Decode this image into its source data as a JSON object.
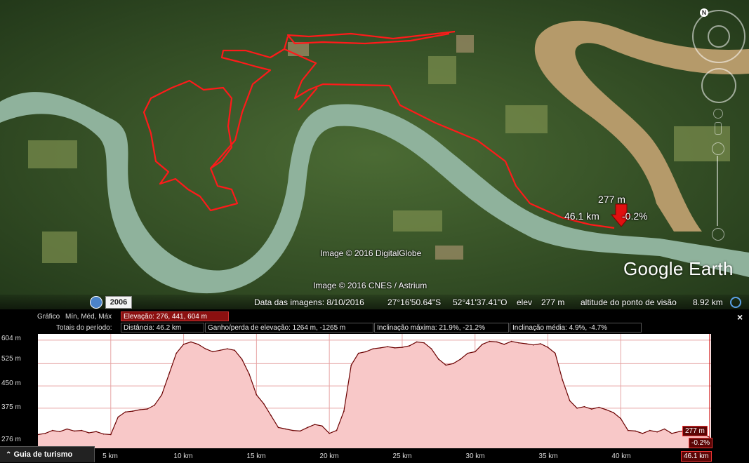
{
  "map": {
    "watermarks": [
      "Image © 2016 DigitalGlobe",
      "Image © 2016 CNES / Astrium"
    ],
    "logo": {
      "part1": "Google",
      "part2": "Earth"
    },
    "marker": {
      "elevation": "277 m",
      "distance": "46.1 km",
      "slope": "-0.2%"
    },
    "colors": {
      "river": "#8fb29c",
      "river_brown": "#b59a6a",
      "track": "#ff1a1a",
      "forest": "#2f4a22"
    }
  },
  "statusbar": {
    "history_year": "2006",
    "image_date": "Data das imagens: 8/10/2016",
    "lat": "27°16'50.64\"S",
    "lon": "52°41'37.41\"O",
    "elev_label": "elev",
    "elev_value": "277 m",
    "eye_label": "altitude do ponto de visão",
    "eye_value": "8.92 km"
  },
  "profile": {
    "graph_label": "Gráfico",
    "graph_options": "Mín, Méd, Máx",
    "elevation_summary": "Elevação: 276, 441, 604 m",
    "totals_label": "Totais do período:",
    "distance": "Distância: 46.2 km",
    "gain_loss": "Ganho/perda de elevação: 1264 m, -1265 m",
    "max_slope": "Inclinação máxima: 21.9%, -21.2%",
    "avg_slope": "Inclinação média: 4.9%, -4.7%",
    "close_label": "×",
    "tour_guide": "Guia de turismo",
    "y_ticks": [
      "604 m",
      "525 m",
      "450 m",
      "375 m",
      "276 m"
    ],
    "x_ticks": [
      "5 km",
      "10 km",
      "15 km",
      "20 km",
      "25 km",
      "30 km",
      "35 km",
      "40 km"
    ],
    "cursor_elev": "277 m",
    "cursor_slope": "-0.2%",
    "cursor_dist": "46.1 km"
  },
  "chart_data": {
    "type": "area",
    "xlabel": "",
    "ylabel": "",
    "xlim": [
      0,
      46.2
    ],
    "ylim": [
      276,
      604
    ],
    "x": [
      0,
      0.5,
      1,
      1.5,
      2,
      2.5,
      3,
      3.5,
      4,
      4.5,
      5,
      5.5,
      6,
      6.5,
      7,
      7.5,
      8,
      8.5,
      9,
      9.5,
      10,
      10.5,
      11,
      11.5,
      12,
      12.5,
      13,
      13.5,
      14,
      14.5,
      15,
      15.5,
      16,
      16.5,
      17,
      17.5,
      18,
      18.5,
      19,
      19.5,
      20,
      20.5,
      21,
      21.5,
      22,
      22.5,
      23,
      23.5,
      24,
      24.5,
      25,
      25.5,
      26,
      26.5,
      27,
      27.5,
      28,
      28.5,
      29,
      29.5,
      30,
      30.5,
      31,
      31.5,
      32,
      32.5,
      33,
      33.5,
      34,
      34.5,
      35,
      35.5,
      36,
      36.5,
      37,
      37.5,
      38,
      38.5,
      39,
      39.5,
      40,
      40.5,
      41,
      41.5,
      42,
      42.5,
      43,
      43.5,
      44,
      44.5,
      45,
      45.5,
      46.1
    ],
    "series": [
      {
        "values": [
          286,
          290,
          300,
          296,
          305,
          298,
          300,
          292,
          296,
          288,
          286,
          345,
          362,
          365,
          370,
          372,
          385,
          420,
          490,
          560,
          590,
          598,
          590,
          575,
          565,
          570,
          575,
          570,
          540,
          490,
          420,
          390,
          350,
          310,
          305,
          300,
          298,
          310,
          320,
          315,
          290,
          300,
          365,
          520,
          560,
          565,
          575,
          578,
          582,
          578,
          580,
          585,
          598,
          595,
          575,
          540,
          520,
          525,
          540,
          560,
          565,
          590,
          600,
          598,
          590,
          600,
          595,
          592,
          588,
          592,
          580,
          560,
          470,
          400,
          375,
          380,
          372,
          378,
          370,
          360,
          340,
          300,
          298,
          290,
          300,
          295,
          305,
          290,
          296,
          300,
          295,
          292,
          277
        ]
      }
    ]
  }
}
